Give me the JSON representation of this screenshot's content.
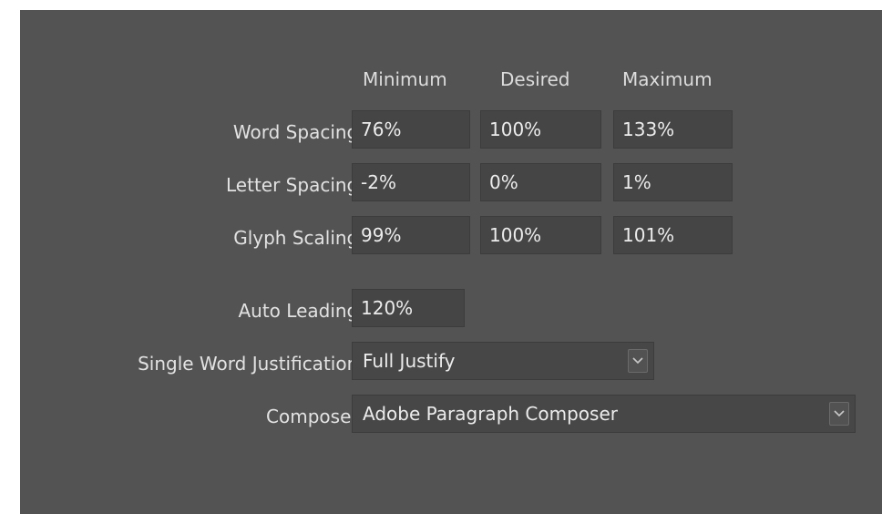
{
  "columns": {
    "minimum": "Minimum",
    "desired": "Desired",
    "maximum": "Maximum"
  },
  "rows": [
    {
      "label": "Word Spacing:",
      "minimum": "76%",
      "desired": "100%",
      "maximum": "133%"
    },
    {
      "label": "Letter Spacing:",
      "minimum": "-2%",
      "desired": "0%",
      "maximum": "1%"
    },
    {
      "label": "Glyph Scaling:",
      "minimum": "99%",
      "desired": "100%",
      "maximum": "101%"
    }
  ],
  "auto_leading": {
    "label": "Auto Leading:",
    "value": "120%"
  },
  "single_word_justification": {
    "label": "Single Word Justification:",
    "value": "Full Justify"
  },
  "composer": {
    "label": "Composer:",
    "value": "Adobe Paragraph Composer"
  },
  "icons": {
    "dropdown": "chevron-down-icon"
  },
  "colors": {
    "panel_bg": "#535353",
    "field_bg": "#454545",
    "text": "#e6e6e6"
  }
}
